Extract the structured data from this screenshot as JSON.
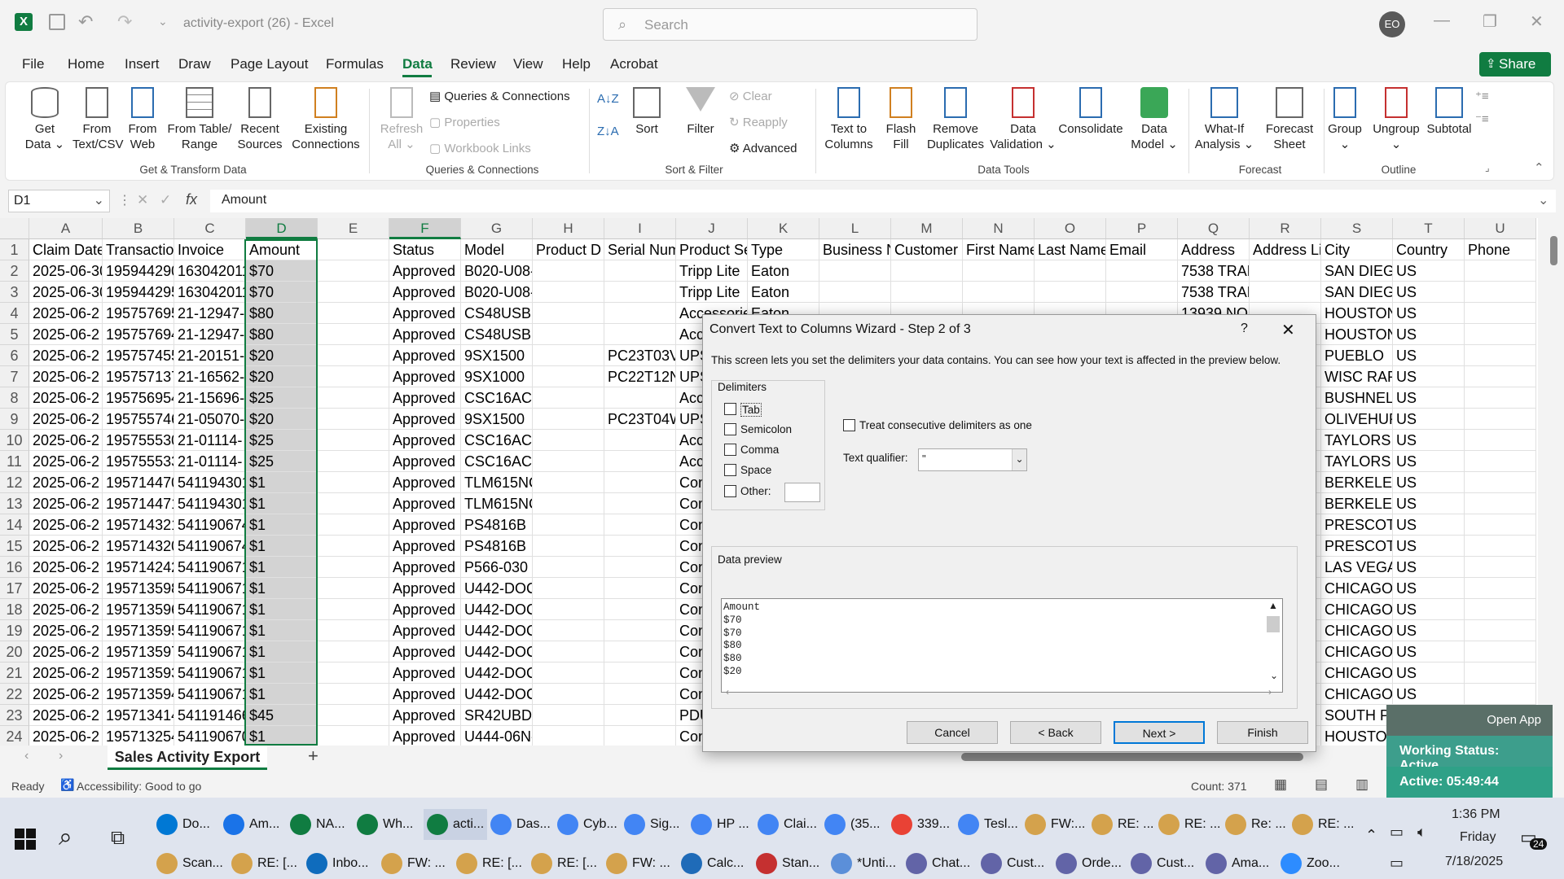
{
  "window": {
    "title": "activity-export (26)  -  Excel",
    "search_placeholder": "Search",
    "user_initials": "EO",
    "share_label": "Share"
  },
  "menu": [
    "File",
    "Home",
    "Insert",
    "Draw",
    "Page Layout",
    "Formulas",
    "Data",
    "Review",
    "View",
    "Help",
    "Acrobat"
  ],
  "ribbon": {
    "get_data": "Get Data ⌄",
    "from_csv": "From Text/CSV",
    "from_web": "From Web",
    "from_table": "From Table/ Range",
    "recent_sources": "Recent Sources",
    "existing_connections": "Existing Connections",
    "group_get": "Get & Transform Data",
    "refresh_all": "Refresh All ⌄",
    "queries_connections": "Queries & Connections",
    "properties": "Properties",
    "workbook_links": "Workbook Links",
    "group_queries": "Queries & Connections",
    "sort": "Sort",
    "filter": "Filter",
    "clear": "Clear",
    "reapply": "Reapply",
    "advanced": "Advanced",
    "group_sort": "Sort & Filter",
    "text_to_columns": "Text to Columns",
    "flash_fill": "Flash Fill",
    "remove_duplicates": "Remove Duplicates",
    "data_validation": "Data Validation ⌄",
    "consolidate": "Consolidate",
    "data_model": "Data Model ⌄",
    "group_tools": "Data Tools",
    "what_if": "What-If Analysis ⌄",
    "forecast_sheet": "Forecast Sheet",
    "group_forecast": "Forecast",
    "group": "Group ⌄",
    "ungroup": "Ungroup ⌄",
    "subtotal": "Subtotal",
    "group_outline": "Outline"
  },
  "formula_bar": {
    "name_box": "D1",
    "fx": "fx",
    "content": "Amount"
  },
  "columns": [
    "A",
    "B",
    "C",
    "D",
    "E",
    "F",
    "G",
    "H",
    "I",
    "J",
    "K",
    "L",
    "M",
    "N",
    "O",
    "P",
    "Q",
    "R",
    "S",
    "T",
    "U"
  ],
  "rows": [
    [
      "Claim Date",
      "Transaction",
      "Invoice",
      "Amount",
      "",
      "Status",
      "Model",
      "Product D",
      "Serial Num",
      "Product Se",
      "Type",
      "Business N",
      "Customer",
      "First Name",
      "Last Name",
      "Email",
      "Address",
      "Address Li",
      "City",
      "Country",
      "Phone"
    ],
    [
      "2025-06-30",
      "195944290",
      "163042011",
      "$70",
      "",
      "Approved",
      "B020-U08-",
      "",
      "",
      "Tripp Lite",
      "Eaton",
      "",
      "",
      "",
      "",
      "",
      "7538 TRAD",
      "",
      "SAN DIEGO",
      "US",
      ""
    ],
    [
      "2025-06-30",
      "195944295",
      "163042011",
      "$70",
      "",
      "Approved",
      "B020-U08-",
      "",
      "",
      "Tripp Lite",
      "Eaton",
      "",
      "",
      "",
      "",
      "",
      "7538 TRAD",
      "",
      "SAN DIEGO",
      "US",
      ""
    ],
    [
      "2025-06-2",
      "195757695",
      "21-12947-",
      "$80",
      "",
      "Approved",
      "CS48USB",
      "",
      "",
      "Accessories",
      "Eaton",
      "",
      "",
      "",
      "",
      "",
      "13939 NO",
      "",
      "HOUSTON",
      "US",
      ""
    ],
    [
      "2025-06-2",
      "195757694",
      "21-12947-",
      "$80",
      "",
      "Approved",
      "CS48USB",
      "",
      "",
      "Accessories",
      "",
      "",
      "",
      "",
      "",
      "",
      "",
      "",
      "HOUSTON",
      "US",
      ""
    ],
    [
      "2025-06-2",
      "195757455",
      "21-20151-",
      "$20",
      "",
      "Approved",
      "9SX1500",
      "",
      "PC23T03V",
      "UPS",
      "",
      "",
      "",
      "",
      "",
      "",
      "",
      "",
      "PUEBLO",
      "US",
      ""
    ],
    [
      "2025-06-2",
      "195757137",
      "21-16562-",
      "$20",
      "",
      "Approved",
      "9SX1000",
      "",
      "PC22T12N",
      "UPS",
      "",
      "",
      "",
      "",
      "",
      "",
      "",
      "",
      "WISC RAPI",
      "US",
      ""
    ],
    [
      "2025-06-2",
      "195756954",
      "21-15696-",
      "$25",
      "",
      "Approved",
      "CSC16AC",
      "",
      "",
      "Accessories",
      "",
      "",
      "",
      "",
      "",
      "",
      "",
      "",
      "BUSHNELL",
      "US",
      ""
    ],
    [
      "2025-06-2",
      "195755746",
      "21-05070-",
      "$20",
      "",
      "Approved",
      "9SX1500",
      "",
      "PC23T04W",
      "UPS",
      "",
      "",
      "",
      "",
      "",
      "",
      "",
      "",
      "OLIVEHUR",
      "US",
      ""
    ],
    [
      "2025-06-2",
      "195755530",
      "21-01114-",
      "$25",
      "",
      "Approved",
      "CSC16AC",
      "",
      "",
      "Accessories",
      "",
      "",
      "",
      "",
      "",
      "",
      "",
      "",
      "TAYLORS",
      "US",
      ""
    ],
    [
      "2025-06-2",
      "195755533",
      "21-01114-",
      "$25",
      "",
      "Approved",
      "CSC16AC",
      "",
      "",
      "Accessories",
      "",
      "",
      "",
      "",
      "",
      "",
      "",
      "",
      "TAYLORS",
      "US",
      ""
    ],
    [
      "2025-06-2",
      "195714470",
      "541194301",
      "$1",
      "",
      "Approved",
      "TLM615NC",
      "",
      "",
      "Connectivity",
      "",
      "",
      "",
      "",
      "",
      "",
      "",
      "",
      "BERKELEY",
      "US",
      ""
    ],
    [
      "2025-06-2",
      "195714471",
      "541194301",
      "$1",
      "",
      "Approved",
      "TLM615NC",
      "",
      "",
      "Connectivity",
      "",
      "",
      "",
      "",
      "",
      "",
      "",
      "",
      "BERKELEY",
      "US",
      ""
    ],
    [
      "2025-06-2",
      "195714321",
      "541190674",
      "$1",
      "",
      "Approved",
      "PS4816B",
      "",
      "",
      "Connectivity",
      "",
      "",
      "",
      "",
      "",
      "",
      "",
      "",
      "PRESCOTT",
      "US",
      ""
    ],
    [
      "2025-06-2",
      "195714320",
      "541190674",
      "$1",
      "",
      "Approved",
      "PS4816B",
      "",
      "",
      "Connectivity",
      "",
      "",
      "",
      "",
      "",
      "",
      "",
      "",
      "PRESCOTT",
      "US",
      ""
    ],
    [
      "2025-06-2",
      "195714242",
      "541190671",
      "$1",
      "",
      "Approved",
      "P566-030",
      "",
      "",
      "Connectivity",
      "",
      "",
      "",
      "",
      "",
      "",
      "",
      "",
      "LAS VEGAS",
      "US",
      ""
    ],
    [
      "2025-06-2",
      "195713598",
      "541190671",
      "$1",
      "",
      "Approved",
      "U442-DOC",
      "",
      "",
      "Connectivity",
      "",
      "",
      "",
      "",
      "",
      "",
      "",
      "",
      "CHICAGO",
      "US",
      ""
    ],
    [
      "2025-06-2",
      "195713596",
      "541190671",
      "$1",
      "",
      "Approved",
      "U442-DOC",
      "",
      "",
      "Connectivity",
      "",
      "",
      "",
      "",
      "",
      "",
      "",
      "",
      "CHICAGO",
      "US",
      ""
    ],
    [
      "2025-06-2",
      "195713595",
      "541190671",
      "$1",
      "",
      "Approved",
      "U442-DOC",
      "",
      "",
      "Connectivity",
      "",
      "",
      "",
      "",
      "",
      "",
      "",
      "",
      "CHICAGO",
      "US",
      ""
    ],
    [
      "2025-06-2",
      "195713597",
      "541190671",
      "$1",
      "",
      "Approved",
      "U442-DOC",
      "",
      "",
      "Connectivity",
      "",
      "",
      "",
      "",
      "",
      "",
      "",
      "",
      "CHICAGO",
      "US",
      ""
    ],
    [
      "2025-06-2",
      "195713593",
      "541190671",
      "$1",
      "",
      "Approved",
      "U442-DOC",
      "",
      "",
      "Connectivity",
      "",
      "",
      "",
      "",
      "",
      "",
      "",
      "",
      "CHICAGO",
      "US",
      ""
    ],
    [
      "2025-06-2",
      "195713594",
      "541190671",
      "$1",
      "",
      "Approved",
      "U442-DOC",
      "",
      "",
      "Connectivity",
      "",
      "",
      "",
      "",
      "",
      "",
      "",
      "",
      "CHICAGO",
      "US",
      ""
    ],
    [
      "2025-06-2",
      "195713414",
      "541191466",
      "$45",
      "",
      "Approved",
      "SR42UBDP",
      "",
      "",
      "PDU",
      "",
      "",
      "",
      "",
      "",
      "",
      "",
      "",
      "SOUTH PO",
      "US",
      ""
    ],
    [
      "2025-06-2",
      "195713254",
      "541190670",
      "$1",
      "",
      "Approved",
      "U444-06N-",
      "",
      "",
      "Connectivity",
      "",
      "",
      "",
      "",
      "",
      "",
      "",
      "",
      "HOUSTON",
      "US",
      ""
    ]
  ],
  "sheet_tab": "Sales Activity Export",
  "status": {
    "ready": "Ready",
    "accessibility": "Accessibility: Good to go",
    "count": "Count: 371"
  },
  "dialog": {
    "title": "Convert Text to Columns Wizard - Step 2 of 3",
    "help": "?",
    "description": "This screen lets you set the delimiters your data contains.  You can see how your text is affected in the preview below.",
    "delimiters_label": "Delimiters",
    "delimiters": [
      "Tab",
      "Semicolon",
      "Comma",
      "Space",
      "Other:"
    ],
    "consecutive": "Treat consecutive delimiters as one",
    "qualifier_label": "Text qualifier:",
    "qualifier_value": "\"",
    "preview_label": "Data preview",
    "preview_lines": [
      "Amount",
      "$70",
      "$70",
      "$80",
      "$80",
      "$20"
    ],
    "buttons": {
      "cancel": "Cancel",
      "back": "< Back",
      "next": "Next >",
      "finish": "Finish"
    }
  },
  "overlay": {
    "open_app": "Open App",
    "working_status": "Working Status: Active",
    "active_timer": "Active: 05:49:44"
  },
  "taskbar": {
    "row1": [
      "Do...",
      "Am...",
      "NA...",
      "Wh...",
      "acti...",
      "Das...",
      "Cyb...",
      "Sig...",
      "HP ...",
      "Clai...",
      "(35...",
      "339...",
      "Tesl...",
      "FW:...",
      "RE: ...",
      "RE: ...",
      "Re: ...",
      "RE: ..."
    ],
    "row2": [
      "Scan...",
      "RE: [...",
      "Inbo...",
      "FW: ...",
      "RE: [...",
      "RE: [...",
      "FW: ...",
      "Calc...",
      "Stan...",
      "*Unti...",
      "Chat...",
      "Cust...",
      "Orde...",
      "Cust...",
      "Ama...",
      "Zoo..."
    ],
    "time": "1:36 PM",
    "day": "Friday",
    "date": "7/18/2025",
    "notif_count": "24"
  },
  "colors": {
    "excel_green": "#107c41",
    "selection": "#d3d3d3"
  }
}
